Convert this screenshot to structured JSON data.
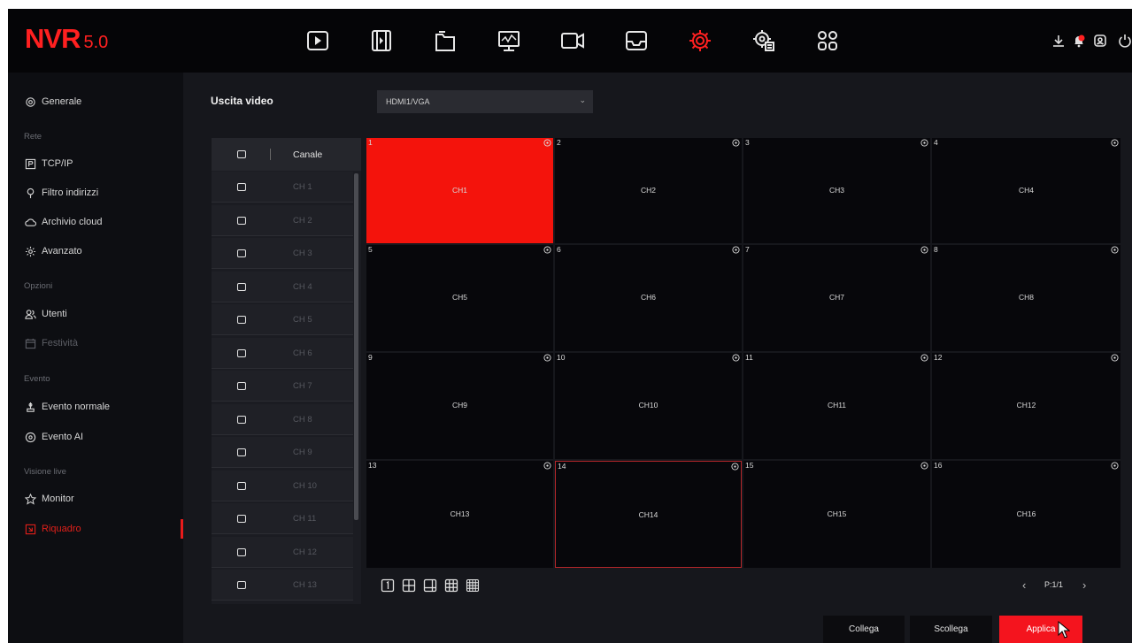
{
  "brand": {
    "name": "NVR",
    "version": "5.0"
  },
  "topnav": {
    "items": [
      {
        "name": "playback-icon"
      },
      {
        "name": "film-icon"
      },
      {
        "name": "files-icon"
      },
      {
        "name": "system-monitor-icon"
      },
      {
        "name": "camera-icon"
      },
      {
        "name": "storage-tray-icon"
      },
      {
        "name": "settings-gear-icon",
        "active": true
      },
      {
        "name": "maintenance-gear-icon"
      },
      {
        "name": "apps-grid-icon"
      }
    ],
    "right": [
      "download-icon",
      "alarm-bell-icon",
      "user-icon",
      "power-icon"
    ]
  },
  "sidebar": {
    "items": [
      {
        "label": "Generale",
        "icon": "gear-icon"
      },
      {
        "section": "Rete"
      },
      {
        "label": "TCP/IP",
        "icon": "p-box-icon"
      },
      {
        "label": "Filtro indirizzi",
        "icon": "filter-icon"
      },
      {
        "label": "Archivio cloud",
        "icon": "cloud-icon"
      },
      {
        "label": "Avanzato",
        "icon": "advanced-gear-icon"
      },
      {
        "section": "Opzioni"
      },
      {
        "label": "Utenti",
        "icon": "users-icon"
      },
      {
        "label": "Festività",
        "icon": "calendar-icon",
        "disabled": true
      },
      {
        "section": "Evento"
      },
      {
        "label": "Evento normale",
        "icon": "event-icon"
      },
      {
        "label": "Evento AI",
        "icon": "ai-target-icon"
      },
      {
        "section": "Visione live"
      },
      {
        "label": "Monitor",
        "icon": "star-icon"
      },
      {
        "label": "Riquadro",
        "icon": "layout-icon",
        "active": true
      }
    ]
  },
  "video_output": {
    "label": "Uscita video",
    "value": "HDMI1/VGA"
  },
  "channel_list": {
    "header": "Canale",
    "rows": [
      "CH 1",
      "CH 2",
      "CH 3",
      "CH 4",
      "CH 5",
      "CH 6",
      "CH 7",
      "CH 8",
      "CH 9",
      "CH 10",
      "CH 11",
      "CH 12",
      "CH 13"
    ]
  },
  "grid": {
    "tiles": [
      {
        "num": "1",
        "label": "CH1",
        "selected": true
      },
      {
        "num": "2",
        "label": "CH2"
      },
      {
        "num": "3",
        "label": "CH3"
      },
      {
        "num": "4",
        "label": "CH4"
      },
      {
        "num": "5",
        "label": "CH5"
      },
      {
        "num": "6",
        "label": "CH6"
      },
      {
        "num": "7",
        "label": "CH7"
      },
      {
        "num": "8",
        "label": "CH8"
      },
      {
        "num": "9",
        "label": "CH9"
      },
      {
        "num": "10",
        "label": "CH10"
      },
      {
        "num": "11",
        "label": "CH11"
      },
      {
        "num": "12",
        "label": "CH12"
      },
      {
        "num": "13",
        "label": "CH13"
      },
      {
        "num": "14",
        "label": "CH14",
        "outlined": true
      },
      {
        "num": "15",
        "label": "CH15"
      },
      {
        "num": "16",
        "label": "CH16"
      }
    ],
    "split_icons": [
      "split-1-icon",
      "split-4-icon",
      "split-6-icon",
      "split-9-icon",
      "split-16-icon"
    ],
    "pager": {
      "prev": "‹",
      "text": "P:1/1",
      "next": "›"
    }
  },
  "buttons": {
    "connect": "Collega",
    "disconnect": "Scollega",
    "apply": "Applica"
  },
  "colors": {
    "accent": "#f4130c",
    "background": "#16171c",
    "sidebar": "#0d0e12",
    "topbar": "#050507"
  }
}
